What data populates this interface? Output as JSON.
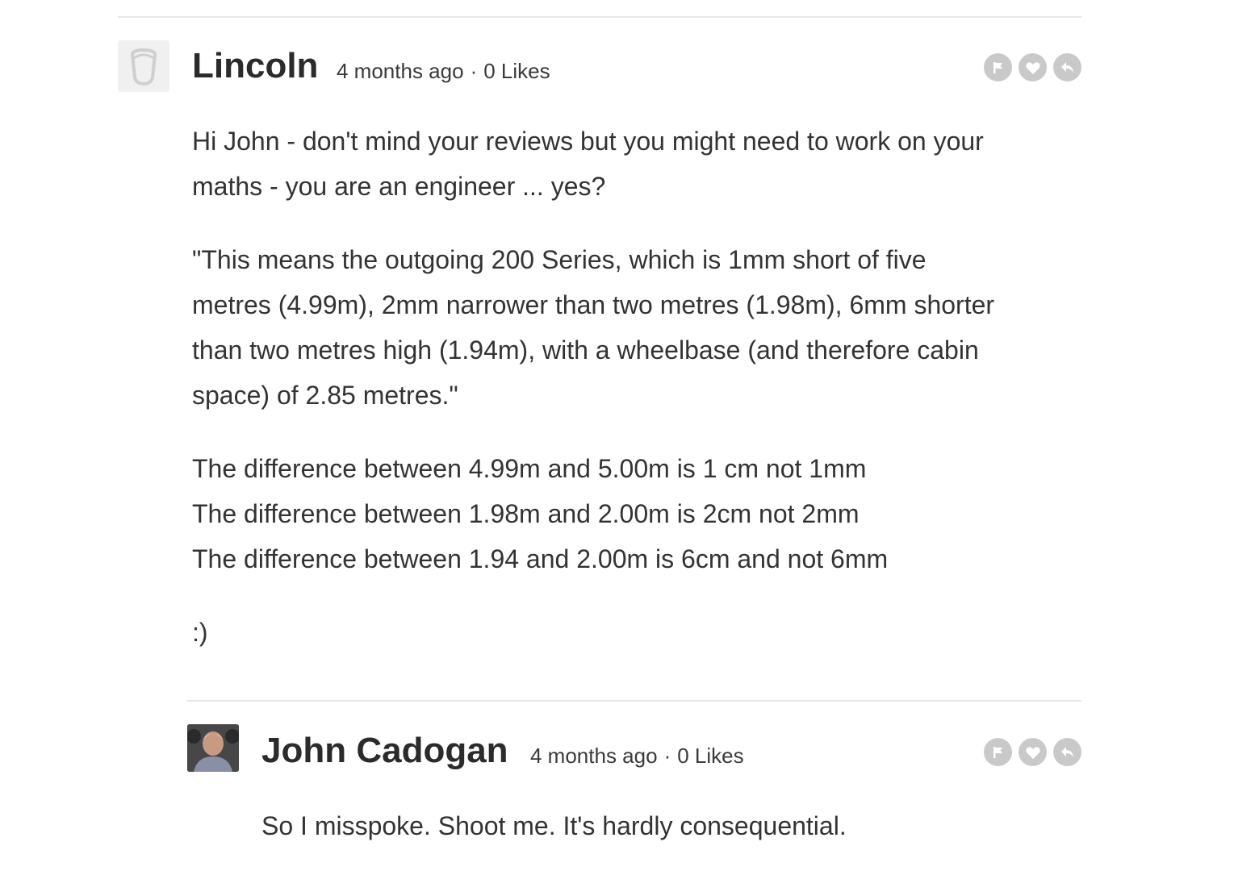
{
  "comments": [
    {
      "author": "Lincoln",
      "time": "4 months ago",
      "separator": "·",
      "likes": "0 Likes",
      "avatar_icon": "default-avatar-icon",
      "body_lines": [
        "Hi John - don't mind your reviews but you might need to work on your",
        "maths - you are an engineer ... yes?",
        "\"This means the outgoing 200 Series, which is 1mm short of five",
        "metres (4.99m), 2mm narrower than two metres (1.98m), 6mm shorter",
        "than two metres high (1.94m), with a wheelbase (and therefore cabin",
        "space) of 2.85 metres.\"",
        "The difference between 4.99m and 5.00m is 1 cm not 1mm",
        "The difference between 1.98m and 2.00m is 2cm not 2mm",
        "The difference between 1.94 and 2.00m is 6cm and not 6mm",
        ":)"
      ],
      "actions": [
        "flag-icon",
        "heart-icon",
        "reply-icon"
      ]
    },
    {
      "author": "John Cadogan",
      "time": "4 months ago",
      "separator": "·",
      "likes": "0 Likes",
      "avatar_icon": "user-photo-avatar",
      "body_lines": [
        "So I misspoke. Shoot me. It's hardly consequential."
      ],
      "actions": [
        "flag-icon",
        "heart-icon",
        "reply-icon"
      ]
    }
  ],
  "colors": {
    "action_icon_bg": "#c9c9c9",
    "divider": "#e6e6e6",
    "text": "#333333"
  }
}
